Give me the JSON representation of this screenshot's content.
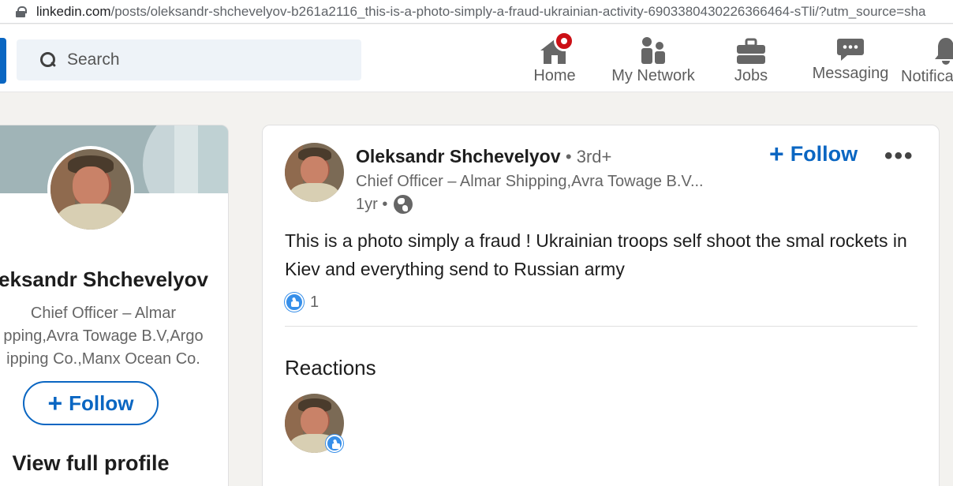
{
  "browser": {
    "url_domain": "linkedin.com",
    "url_path": "/posts/oleksandr-shchevelyov-b261a2116_this-is-a-photo-simply-a-fraud-ukrainian-activity-6903380430226366464-sTli/?utm_source=sha"
  },
  "nav": {
    "search_placeholder": "Search",
    "items": [
      {
        "label": "Home",
        "icon": "home-icon"
      },
      {
        "label": "My Network",
        "icon": "network-icon"
      },
      {
        "label": "Jobs",
        "icon": "briefcase-icon"
      },
      {
        "label": "Messaging",
        "icon": "messaging-icon"
      },
      {
        "label": "Notifica",
        "icon": "bell-icon"
      }
    ]
  },
  "profile_card": {
    "name": "eksandr Shchevelyov",
    "headline_lines": [
      "Chief Officer – Almar",
      "pping,Avra Towage B.V,Argo",
      "ipping Co.,Manx Ocean Co."
    ],
    "follow_label": "Follow",
    "view_full_profile": "View full profile"
  },
  "post": {
    "author": "Oleksandr Shchevelyov",
    "degree": "• 3rd+",
    "headline": "Chief Officer – Almar Shipping,Avra Towage B.V...",
    "time": "1yr •",
    "follow_label": "Follow",
    "more_label": "•••",
    "text": "This is a photo simply a fraud ! Ukrainian troops self shoot the smal rockets in Kiev and everything send to Russian army",
    "like_count": "1",
    "reactions_title": "Reactions"
  },
  "colors": {
    "brand_blue": "#0a66c2",
    "notification_red": "#cc1016",
    "like_blue": "#378fe9"
  }
}
